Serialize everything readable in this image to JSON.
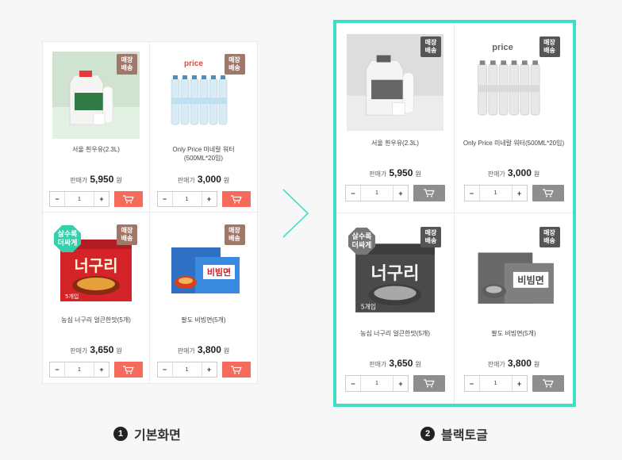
{
  "panels": [
    {
      "caption_number": "1",
      "caption": "기본화면",
      "products": [
        {
          "name": "서울 흰우유(2.3L)",
          "price_label": "판매가",
          "price": "5,950",
          "won": "원",
          "qty": "1",
          "store_badge": "매장\n배송",
          "more_badge": ""
        },
        {
          "name": "Only Price 미네랄 워터(500ML*20입)",
          "price_label": "판매가",
          "price": "3,000",
          "won": "원",
          "qty": "1",
          "store_badge": "매장\n배송",
          "more_badge": ""
        },
        {
          "name": "농심 너구리 얼큰한맛(5개)",
          "price_label": "판매가",
          "price": "3,650",
          "won": "원",
          "qty": "1",
          "store_badge": "매장\n배송",
          "more_badge": "살수록\n더싸게"
        },
        {
          "name": "팔도 비빔면(5개)",
          "price_label": "판매가",
          "price": "3,800",
          "won": "원",
          "qty": "1",
          "store_badge": "매장\n배송",
          "more_badge": ""
        }
      ]
    },
    {
      "caption_number": "2",
      "caption": "블랙토글",
      "products": [
        {
          "name": "서울 흰우유(2.3L)",
          "price_label": "판매가",
          "price": "5,950",
          "won": "원",
          "qty": "1",
          "store_badge": "매장\n배송",
          "more_badge": ""
        },
        {
          "name": "Only Price 미네랄 워터(500ML*20입)",
          "price_label": "판매가",
          "price": "3,000",
          "won": "원",
          "qty": "1",
          "store_badge": "매장\n배송",
          "more_badge": ""
        },
        {
          "name": "농심 너구리 얼큰한맛(5개)",
          "price_label": "판매가",
          "price": "3,650",
          "won": "원",
          "qty": "1",
          "store_badge": "매장\n배송",
          "more_badge": "살수록\n더싸게"
        },
        {
          "name": "팔도 비빔면(5개)",
          "price_label": "판매가",
          "price": "3,800",
          "won": "원",
          "qty": "1",
          "store_badge": "매장\n배송",
          "more_badge": ""
        }
      ]
    }
  ],
  "stepper": {
    "minus": "−",
    "plus": "+"
  },
  "product_images": [
    "milk-carton-image",
    "water-bottles-image",
    "neoguri-ramen-image",
    "bibim-noodle-image"
  ],
  "image_text": {
    "price_logo": "price",
    "ramen_title": "너구리",
    "bibim_title": "비빔면",
    "ramen_count": "5개입"
  },
  "colors": {
    "accent_border": "#3ee0c5",
    "cart_default": "#f56a5a",
    "cart_toggled": "#8e8e8e",
    "badge_store": "#a0786a",
    "badge_more": "#35cfa9"
  }
}
